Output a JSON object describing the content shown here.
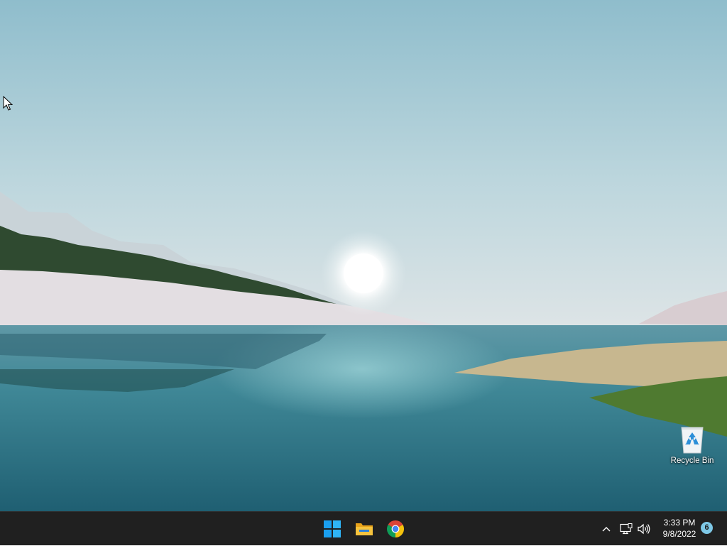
{
  "desktop": {
    "wallpaper": "Windows 11 Glow lake landscape (placeholder)",
    "icons": [
      {
        "label": "Recycle Bin",
        "icon": "recycle-bin-icon"
      }
    ]
  },
  "taskbar": {
    "pinned": [
      {
        "name": "Start",
        "icon": "windows-logo-icon"
      },
      {
        "name": "File Explorer",
        "icon": "folder-icon"
      },
      {
        "name": "Google Chrome",
        "icon": "chrome-icon"
      }
    ],
    "tray": {
      "chevron_icon": "chevron-up-icon",
      "network_icon": "network-icon",
      "volume_icon": "volume-icon",
      "time": "3:33 PM",
      "date": "9/8/2022",
      "notification_count": "6"
    },
    "colors": {
      "taskbar_bg": "#202020",
      "accent": "#4cc2ff",
      "badge": "#7ec8e6"
    }
  }
}
